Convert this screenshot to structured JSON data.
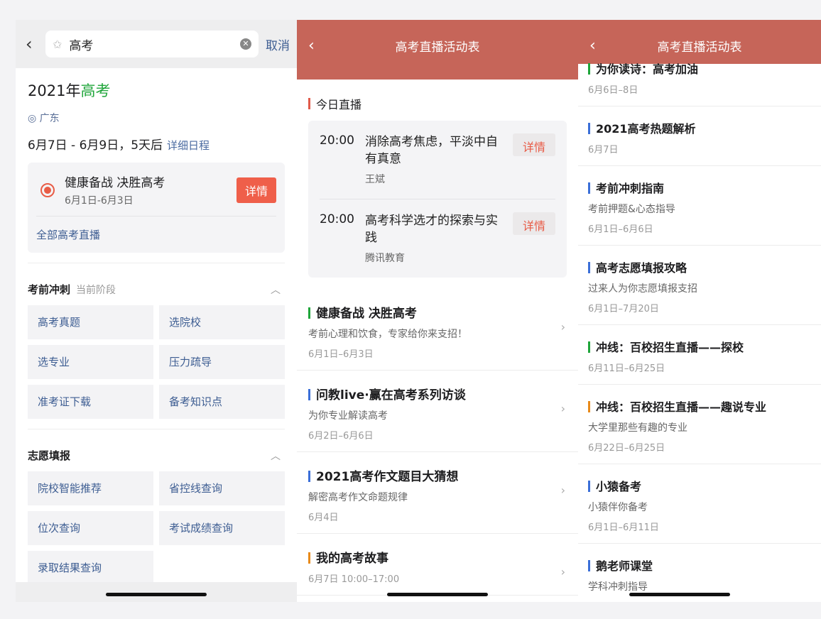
{
  "screen1": {
    "search_query": "高考",
    "cancel": "取消",
    "title_prefix": "2021年",
    "title_highlight": "高考",
    "location": "广东",
    "date_range": "6月7日 - 6月9日，5天后",
    "schedule_link": "详细日程",
    "live_card": {
      "title": "健康备战 决胜高考",
      "dates": "6月1日-6月3日",
      "button": "详情",
      "all_link": "全部高考直播"
    },
    "section1": {
      "title": "考前冲刺",
      "sub": "当前阶段",
      "items": [
        "高考真题",
        "选院校",
        "选专业",
        "压力疏导",
        "准考证下载",
        "备考知识点"
      ]
    },
    "section2": {
      "title": "志愿填报",
      "items": [
        "院校智能推荐",
        "省控线查询",
        "位次查询",
        "考试成绩查询",
        "录取结果查询"
      ]
    }
  },
  "screen2": {
    "header": "高考直播活动表",
    "today_title": "今日直播",
    "today": [
      {
        "time": "20:00",
        "title": "消除高考焦虑，平淡中自有真意",
        "host": "王斌",
        "button": "详情"
      },
      {
        "time": "20:00",
        "title": "高考科学选才的探索与实践",
        "host": "腾讯教育",
        "button": "详情"
      }
    ],
    "list": [
      {
        "title": "健康备战 决胜高考",
        "sub": "考前心理和饮食，专家给你来支招！",
        "date": "6月1日–6月3日",
        "color": "#1fa53a"
      },
      {
        "title": "问教live·赢在高考系列访谈",
        "sub": "为你专业解读高考",
        "date": "6月2日–6月6日",
        "color": "#3b6fd8"
      },
      {
        "title": "2021高考作文题目大猜想",
        "sub": "解密高考作文命题规律",
        "date": "6月4日",
        "color": "#3b6fd8"
      },
      {
        "title": "我的高考故事",
        "sub": "",
        "date": "6月7日 10:00–17:00",
        "color": "#e88a1a"
      }
    ]
  },
  "screen3": {
    "header": "高考直播活动表",
    "list": [
      {
        "title": "为你读诗：高考加油",
        "sub": "",
        "date": "6月6日–8日",
        "color": "#1fa53a"
      },
      {
        "title": "2021高考热题解析",
        "sub": "",
        "date": "6月7日",
        "color": "#3b6fd8"
      },
      {
        "title": "考前冲刺指南",
        "sub": "考前押题&心态指导",
        "date": "6月1日–6月6日",
        "color": "#3b6fd8"
      },
      {
        "title": "高考志愿填报攻略",
        "sub": "过来人为你志愿填报支招",
        "date": "6月1日–7月20日",
        "color": "#3b6fd8"
      },
      {
        "title": "冲线：百校招生直播——探校",
        "sub": "",
        "date": "6月11日–6月25日",
        "color": "#1fa53a"
      },
      {
        "title": "冲线：百校招生直播——趣说专业",
        "sub": "大学里那些有趣的专业",
        "date": "6月22日–6月25日",
        "color": "#e88a1a"
      },
      {
        "title": "小猿备考",
        "sub": "小猿伴你备考",
        "date": "6月1日–6月11日",
        "color": "#3b6fd8"
      },
      {
        "title": "鹅老师课堂",
        "sub": "学科冲刺指导",
        "date": "",
        "color": "#3b6fd8"
      }
    ]
  },
  "icons": {
    "back": "chevron-left-icon",
    "location": "location-pin-icon",
    "clear": "clear-icon",
    "collapse": "chevron-up-icon",
    "chevron": "chevron-right-icon"
  }
}
